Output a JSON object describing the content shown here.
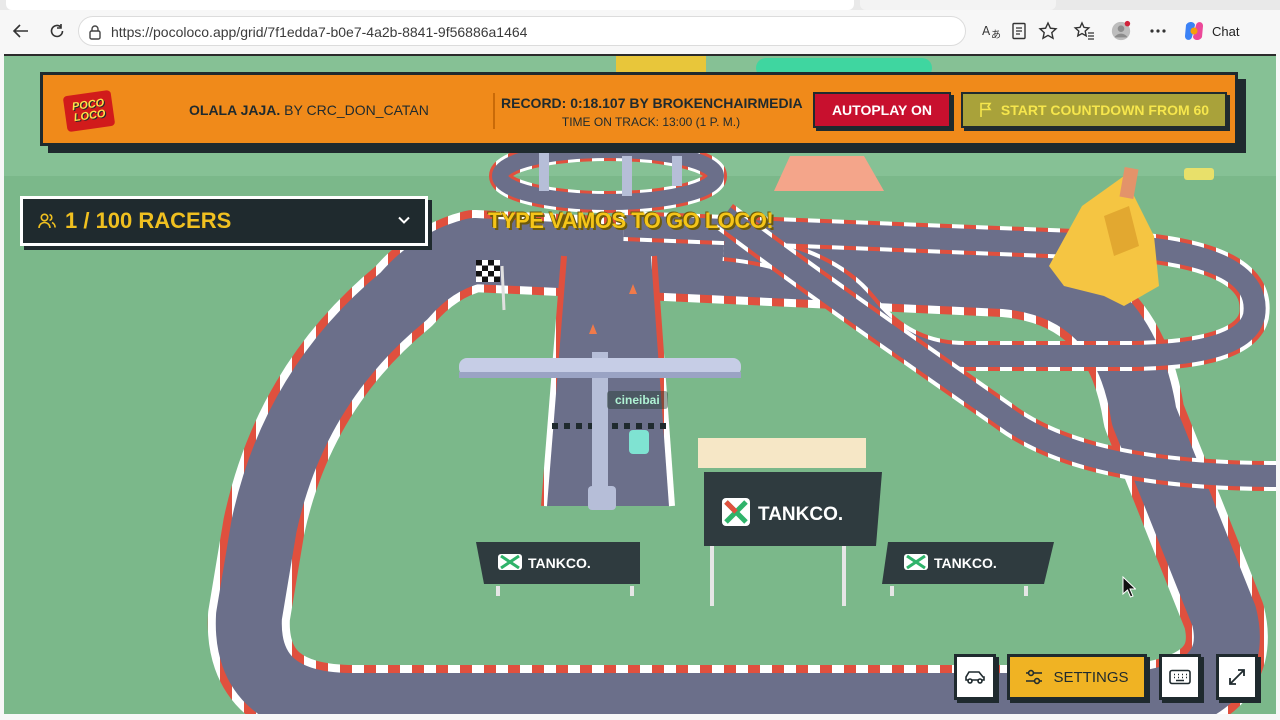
{
  "browser": {
    "url": "https://pocoloco.app/grid/7f1edda7-b0e7-4a2b-8841-9f56886a1464",
    "chat_label": "Chat"
  },
  "banner": {
    "logo_line1": "POCO",
    "logo_line2": "LOCO",
    "track_title": "OLALA JAJA.",
    "track_author": "BY CRC_DON_CATAN",
    "record": "RECORD: 0:18.107 BY BROKENCHAIRMEDIA",
    "time_on_track": "TIME ON TRACK: 13:00 (1 P. M.)",
    "autoplay_label": "AUTOPLAY ON",
    "countdown_label": "START COUNTDOWN FROM 60"
  },
  "racers": {
    "label": "1 / 100 RACERS"
  },
  "prompt": "TYPE VAMOS TO GO LOCO!",
  "player_name": "cineibai",
  "billboards": {
    "brand": "TANKCO."
  },
  "controls": {
    "settings_label": "SETTINGS"
  },
  "colors": {
    "banner": "#f08a1a",
    "dark": "#1f2a2e",
    "grass": "#7bb88a",
    "track": "#6b6f8a",
    "accent_yellow": "#f0b323",
    "autoplay_red": "#c8102e"
  }
}
